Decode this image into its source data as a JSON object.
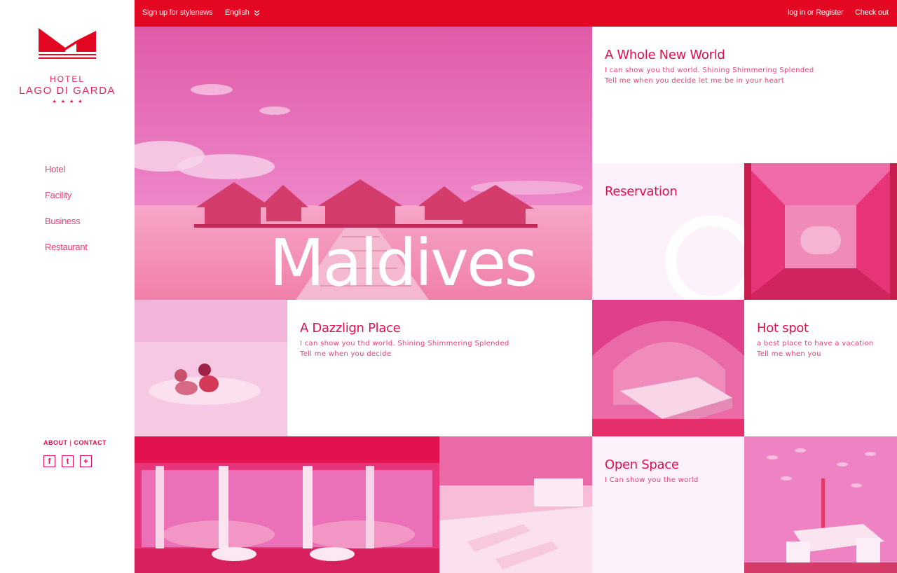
{
  "brand": {
    "hotel": "HOTEL",
    "name": "LAGO DI GARDA",
    "stars": "★★★★"
  },
  "nav": {
    "items": [
      {
        "label": "Hotel"
      },
      {
        "label": "Facility"
      },
      {
        "label": "Business"
      },
      {
        "label": "Restaurant"
      }
    ]
  },
  "footer": {
    "about": "ABOUT",
    "separator": "|",
    "contact": "CONTACT",
    "social": {
      "facebook": "f",
      "twitter": "t",
      "plus": "+"
    }
  },
  "topbar": {
    "signup": "Sign up for stylenews",
    "language": "English",
    "login": "log in or Register",
    "checkout": "Check out"
  },
  "hero": {
    "title": "Maldives"
  },
  "tiles": {
    "whole_new_world": {
      "title": "A Whole New World",
      "lines": [
        "I can show you thd world. Shining Shimmering Splended",
        "Tell me when you decide let me be in your heart"
      ]
    },
    "reservation": {
      "title": "Reservation"
    },
    "dazzling": {
      "title": "A Dazzlign Place",
      "lines": [
        "I can show you thd world. Shining Shimmering Splended",
        "Tell me when you decide"
      ]
    },
    "hot_spot": {
      "title": "Hot spot",
      "lines": [
        "a best place to have a vacation",
        "Tell me when you"
      ]
    },
    "open_space": {
      "title": "Open Space",
      "lines": [
        "I Can show you the world"
      ]
    }
  },
  "colors": {
    "brand_red": "#e30722",
    "accent_pink": "#e30d4f",
    "tint_bg": "#fdf2fb"
  }
}
